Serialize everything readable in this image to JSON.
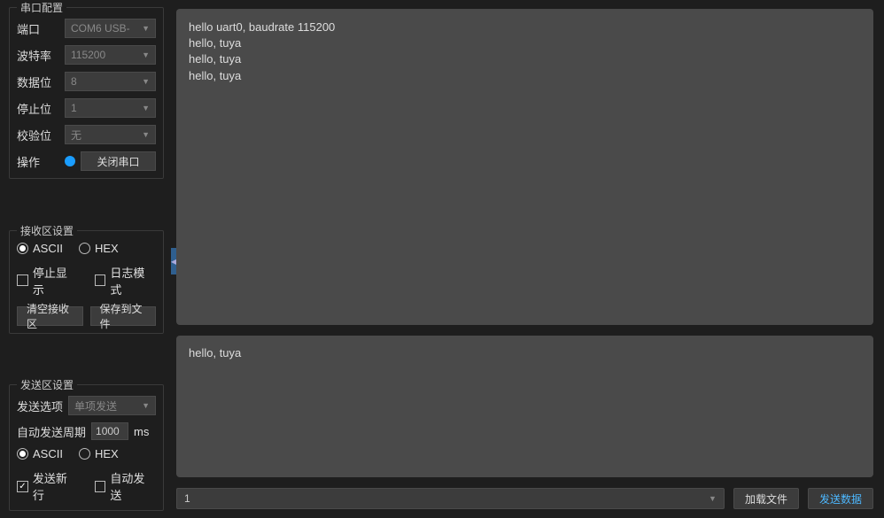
{
  "serial_config": {
    "title": "串口配置",
    "port_label": "端口",
    "port_value": "COM6 USB-",
    "baud_label": "波特率",
    "baud_value": "115200",
    "databits_label": "数据位",
    "databits_value": "8",
    "stopbits_label": "停止位",
    "stopbits_value": "1",
    "parity_label": "校验位",
    "parity_value": "无",
    "action_label": "操作",
    "close_button": "关闭串口"
  },
  "rx_config": {
    "title": "接收区设置",
    "ascii_label": "ASCII",
    "hex_label": "HEX",
    "ascii_selected": true,
    "pause_label": "停止显示",
    "pause_checked": false,
    "log_label": "日志模式",
    "log_checked": false,
    "clear_button": "清空接收区",
    "save_button": "保存到文件"
  },
  "tx_config": {
    "title": "发送区设置",
    "send_option_label": "发送选项",
    "send_option_value": "单项发送",
    "auto_period_label": "自动发送周期",
    "auto_period_value": "1000",
    "auto_period_unit": "ms",
    "ascii_label": "ASCII",
    "hex_label": "HEX",
    "ascii_selected": true,
    "newline_label": "发送新行",
    "newline_checked": true,
    "autosend_label": "自动发送",
    "autosend_checked": false
  },
  "rx_content": "hello uart0, baudrate 115200\nhello, tuya\nhello, tuya\nhello, tuya",
  "tx_content": "hello, tuya",
  "bottom_bar": {
    "count_value": "1",
    "load_file_button": "加载文件",
    "send_button": "发送数据"
  }
}
